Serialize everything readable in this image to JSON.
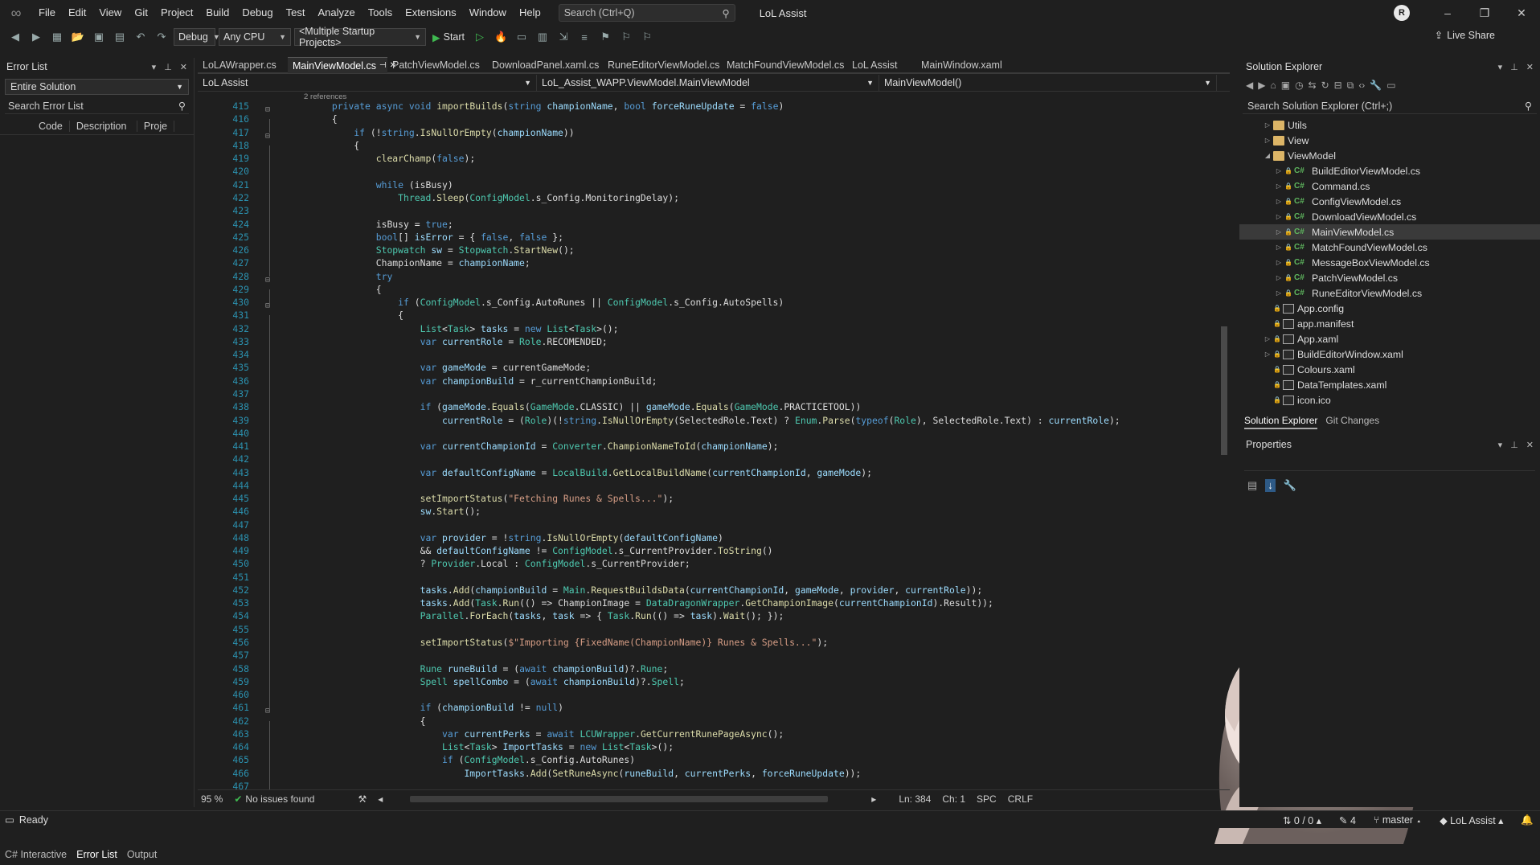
{
  "titlebar": {
    "menu": [
      "File",
      "Edit",
      "View",
      "Git",
      "Project",
      "Build",
      "Debug",
      "Test",
      "Analyze",
      "Tools",
      "Extensions",
      "Window",
      "Help"
    ],
    "search_placeholder": "Search (Ctrl+Q)",
    "app_title": "LoL Assist",
    "avatar_initials": "R"
  },
  "toolbar": {
    "config": "Debug",
    "platform": "Any CPU",
    "startup": "<Multiple Startup Projects>",
    "start_label": "Start",
    "live_share": "Live Share"
  },
  "error_list": {
    "title": "Error List",
    "scope": "Entire Solution",
    "search_placeholder": "Search Error List",
    "columns": [
      "Code",
      "Description",
      "Proje"
    ],
    "bottom_tabs": [
      "C# Interactive",
      "Error List",
      "Output"
    ]
  },
  "editor": {
    "tabs": [
      {
        "label": "LoLAWrapper.cs",
        "active": false
      },
      {
        "label": "MainViewModel.cs",
        "active": true
      },
      {
        "label": "PatchViewModel.cs",
        "active": false
      },
      {
        "label": "DownloadPanel.xaml.cs",
        "active": false
      },
      {
        "label": "RuneEditorViewModel.cs",
        "active": false
      },
      {
        "label": "MatchFoundViewModel.cs",
        "active": false
      },
      {
        "label": "LoL Assist",
        "active": false
      },
      {
        "label": "MainWindow.xaml",
        "active": false
      }
    ],
    "nav_project": "LoL Assist",
    "nav_class": "LoL_Assist_WAPP.ViewModel.MainViewModel",
    "nav_member": "MainViewModel()",
    "codelens": "2 references",
    "lines": [
      {
        "n": "415",
        "t": "        private async void importBuilds(string championName, bool forceRuneUpdate = false)"
      },
      {
        "n": "416",
        "t": "        {"
      },
      {
        "n": "417",
        "t": "            if (!string.IsNullOrEmpty(championName))"
      },
      {
        "n": "418",
        "t": "            {"
      },
      {
        "n": "419",
        "t": "                clearChamp(false);"
      },
      {
        "n": "420",
        "t": ""
      },
      {
        "n": "421",
        "t": "                while (isBusy)"
      },
      {
        "n": "422",
        "t": "                    Thread.Sleep(ConfigModel.s_Config.MonitoringDelay);"
      },
      {
        "n": "423",
        "t": ""
      },
      {
        "n": "424",
        "t": "                isBusy = true;"
      },
      {
        "n": "425",
        "t": "                bool[] isError = { false, false };"
      },
      {
        "n": "426",
        "t": "                Stopwatch sw = Stopwatch.StartNew();"
      },
      {
        "n": "427",
        "t": "                ChampionName = championName;"
      },
      {
        "n": "428",
        "t": "                try"
      },
      {
        "n": "429",
        "t": "                {"
      },
      {
        "n": "430",
        "t": "                    if (ConfigModel.s_Config.AutoRunes || ConfigModel.s_Config.AutoSpells)"
      },
      {
        "n": "431",
        "t": "                    {"
      },
      {
        "n": "432",
        "t": "                        List<Task> tasks = new List<Task>();"
      },
      {
        "n": "433",
        "t": "                        var currentRole = Role.RECOMENDED;"
      },
      {
        "n": "434",
        "t": ""
      },
      {
        "n": "435",
        "t": "                        var gameMode = currentGameMode;"
      },
      {
        "n": "436",
        "t": "                        var championBuild = r_currentChampionBuild;"
      },
      {
        "n": "437",
        "t": ""
      },
      {
        "n": "438",
        "t": "                        if (gameMode.Equals(GameMode.CLASSIC) || gameMode.Equals(GameMode.PRACTICETOOL))"
      },
      {
        "n": "439",
        "t": "                            currentRole = (Role)(!string.IsNullOrEmpty(SelectedRole.Text) ? Enum.Parse(typeof(Role), SelectedRole.Text) : currentRole);"
      },
      {
        "n": "440",
        "t": ""
      },
      {
        "n": "441",
        "t": "                        var currentChampionId = Converter.ChampionNameToId(championName);"
      },
      {
        "n": "442",
        "t": ""
      },
      {
        "n": "443",
        "t": "                        var defaultConfigName = LocalBuild.GetLocalBuildName(currentChampionId, gameMode);"
      },
      {
        "n": "444",
        "t": ""
      },
      {
        "n": "445",
        "t": "                        setImportStatus(\"Fetching Runes & Spells...\");"
      },
      {
        "n": "446",
        "t": "                        sw.Start();"
      },
      {
        "n": "447",
        "t": ""
      },
      {
        "n": "448",
        "t": "                        var provider = !string.IsNullOrEmpty(defaultConfigName)"
      },
      {
        "n": "449",
        "t": "                        && defaultConfigName != ConfigModel.s_CurrentProvider.ToString()"
      },
      {
        "n": "450",
        "t": "                        ? Provider.Local : ConfigModel.s_CurrentProvider;"
      },
      {
        "n": "451",
        "t": ""
      },
      {
        "n": "452",
        "t": "                        tasks.Add(championBuild = Main.RequestBuildsData(currentChampionId, gameMode, provider, currentRole));"
      },
      {
        "n": "453",
        "t": "                        tasks.Add(Task.Run(() => ChampionImage = DataDragonWrapper.GetChampionImage(currentChampionId).Result));"
      },
      {
        "n": "454",
        "t": "                        Parallel.ForEach(tasks, task => { Task.Run(() => task).Wait(); });"
      },
      {
        "n": "455",
        "t": ""
      },
      {
        "n": "456",
        "t": "                        setImportStatus($\"Importing {FixedName(ChampionName)} Runes & Spells...\");"
      },
      {
        "n": "457",
        "t": ""
      },
      {
        "n": "458",
        "t": "                        Rune runeBuild = (await championBuild)?.Rune;"
      },
      {
        "n": "459",
        "t": "                        Spell spellCombo = (await championBuild)?.Spell;"
      },
      {
        "n": "460",
        "t": ""
      },
      {
        "n": "461",
        "t": "                        if (championBuild != null)"
      },
      {
        "n": "462",
        "t": "                        {"
      },
      {
        "n": "463",
        "t": "                            var currentPerks = await LCUWrapper.GetCurrentRunePageAsync();"
      },
      {
        "n": "464",
        "t": "                            List<Task> ImportTasks = new List<Task>();"
      },
      {
        "n": "465",
        "t": "                            if (ConfigModel.s_Config.AutoRunes)"
      },
      {
        "n": "466",
        "t": "                                ImportTasks.Add(SetRuneAsync(runeBuild, currentPerks, forceRuneUpdate));"
      },
      {
        "n": "467",
        "t": ""
      }
    ],
    "zoom": "95 %",
    "issues": "No issues found",
    "ln": "Ln: 384",
    "ch": "Ch: 1",
    "spc": "SPC",
    "eol": "CRLF"
  },
  "solution_explorer": {
    "title": "Solution Explorer",
    "search_placeholder": "Search Solution Explorer (Ctrl+;)",
    "items": [
      {
        "label": "Utils",
        "kind": "folder",
        "depth": 1,
        "exp": "▷"
      },
      {
        "label": "View",
        "kind": "folder",
        "depth": 1,
        "exp": "▷"
      },
      {
        "label": "ViewModel",
        "kind": "folder-open",
        "depth": 1,
        "exp": "◢"
      },
      {
        "label": "BuildEditorViewModel.cs",
        "kind": "cs",
        "depth": 2,
        "exp": "▷"
      },
      {
        "label": "Command.cs",
        "kind": "cs",
        "depth": 2,
        "exp": "▷"
      },
      {
        "label": "ConfigViewModel.cs",
        "kind": "cs",
        "depth": 2,
        "exp": "▷"
      },
      {
        "label": "DownloadViewModel.cs",
        "kind": "cs",
        "depth": 2,
        "exp": "▷"
      },
      {
        "label": "MainViewModel.cs",
        "kind": "cs",
        "depth": 2,
        "exp": "▷",
        "selected": true
      },
      {
        "label": "MatchFoundViewModel.cs",
        "kind": "cs",
        "depth": 2,
        "exp": "▷"
      },
      {
        "label": "MessageBoxViewModel.cs",
        "kind": "cs",
        "depth": 2,
        "exp": "▷"
      },
      {
        "label": "PatchViewModel.cs",
        "kind": "cs",
        "depth": 2,
        "exp": "▷"
      },
      {
        "label": "RuneEditorViewModel.cs",
        "kind": "cs",
        "depth": 2,
        "exp": "▷"
      },
      {
        "label": "App.config",
        "kind": "file",
        "depth": 1,
        "exp": ""
      },
      {
        "label": "app.manifest",
        "kind": "file",
        "depth": 1,
        "exp": ""
      },
      {
        "label": "App.xaml",
        "kind": "file",
        "depth": 1,
        "exp": "▷"
      },
      {
        "label": "BuildEditorWindow.xaml",
        "kind": "file",
        "depth": 1,
        "exp": "▷"
      },
      {
        "label": "Colours.xaml",
        "kind": "file",
        "depth": 1,
        "exp": ""
      },
      {
        "label": "DataTemplates.xaml",
        "kind": "file",
        "depth": 1,
        "exp": ""
      },
      {
        "label": "icon.ico",
        "kind": "file",
        "depth": 1,
        "exp": ""
      }
    ],
    "tabs": [
      "Solution Explorer",
      "Git Changes"
    ]
  },
  "properties": {
    "title": "Properties"
  },
  "statusbar": {
    "ready": "Ready",
    "sync": "0 / 0",
    "changes": "4",
    "branch": "master",
    "repo": "LoL Assist"
  },
  "colors": {
    "keyword": "#569cd6",
    "type": "#4ec9b0",
    "method": "#dcdcaa",
    "param": "#9cdcfe",
    "string": "#d69d85",
    "plain": "#dcdcdc",
    "linenum": "#2b91af"
  }
}
